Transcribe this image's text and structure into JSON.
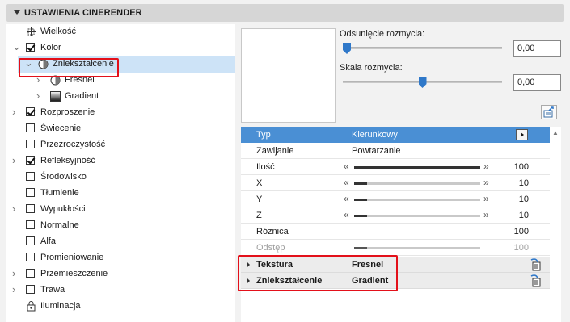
{
  "header": {
    "title": "USTAWIENIA CINERENDER"
  },
  "tree": [
    {
      "label": "Wielkość",
      "checkbox": "icon",
      "icon": "size-arrows-icon",
      "chevron": false,
      "indent": 0
    },
    {
      "label": "Kolor",
      "checkbox": true,
      "chevron": "down",
      "indent": 0
    },
    {
      "label": "Zniekształcenie",
      "checkbox": "icon",
      "icon": "sphere-icon",
      "chevron": "down",
      "indent": 1,
      "selected": true,
      "highlighted": true
    },
    {
      "label": "Fresnel",
      "checkbox": "icon",
      "icon": "sphere-icon",
      "chevron": "right",
      "indent": 2
    },
    {
      "label": "Gradient",
      "checkbox": "icon",
      "icon": "gradient-icon",
      "chevron": "right",
      "indent": 2
    },
    {
      "label": "Rozproszenie",
      "checkbox": true,
      "chevron": "right",
      "indent": 0
    },
    {
      "label": "Świecenie",
      "checkbox": false,
      "chevron": false,
      "indent": 0
    },
    {
      "label": "Przezroczystość",
      "checkbox": false,
      "chevron": false,
      "indent": 0
    },
    {
      "label": "Refleksyjność",
      "checkbox": true,
      "chevron": "right",
      "indent": 0
    },
    {
      "label": "Środowisko",
      "checkbox": false,
      "chevron": false,
      "indent": 0
    },
    {
      "label": "Tłumienie",
      "checkbox": false,
      "chevron": false,
      "indent": 0
    },
    {
      "label": "Wypukłości",
      "checkbox": false,
      "chevron": "right",
      "indent": 0
    },
    {
      "label": "Normalne",
      "checkbox": false,
      "chevron": false,
      "indent": 0
    },
    {
      "label": "Alfa",
      "checkbox": false,
      "chevron": false,
      "indent": 0
    },
    {
      "label": "Promieniowanie",
      "checkbox": false,
      "chevron": false,
      "indent": 0
    },
    {
      "label": "Przemieszczenie",
      "checkbox": false,
      "chevron": "right",
      "indent": 0
    },
    {
      "label": "Trawa",
      "checkbox": false,
      "chevron": "right",
      "indent": 0
    },
    {
      "label": "Iluminacja",
      "checkbox": "icon",
      "icon": "lock-icon",
      "chevron": false,
      "indent": 0
    }
  ],
  "sliders": {
    "blur_offset": {
      "label": "Odsunięcie rozmycia:",
      "value": "0,00",
      "level": 0.0
    },
    "blur_scale": {
      "label": "Skala rozmycia:",
      "value": "0,00",
      "level": 0.5
    }
  },
  "params": [
    {
      "key": "Typ",
      "value": "Kierunkowy",
      "kind": "head"
    },
    {
      "key": "Zawijanie",
      "value": "Powtarzanie",
      "kind": "text"
    },
    {
      "key": "Ilość",
      "number": "100",
      "level": 1.0,
      "kind": "slider"
    },
    {
      "key": "X",
      "number": "10",
      "level": 0.1,
      "kind": "slider"
    },
    {
      "key": "Y",
      "number": "10",
      "level": 0.1,
      "kind": "slider"
    },
    {
      "key": "Z",
      "number": "10",
      "level": 0.1,
      "kind": "slider"
    },
    {
      "key": "Różnica",
      "number": "100",
      "kind": "number"
    },
    {
      "key": "Odstęp",
      "number": "100",
      "level": 0.1,
      "kind": "slider-dim"
    }
  ],
  "subs": [
    {
      "key": "Tekstura",
      "value": "Fresnel"
    },
    {
      "key": "Zniekształcenie",
      "value": "Gradient"
    }
  ],
  "colors": {
    "accent": "#4a8fd4",
    "selected": "#cde3f7",
    "highlight": "#e3101a",
    "thumb": "#2f78c9"
  }
}
